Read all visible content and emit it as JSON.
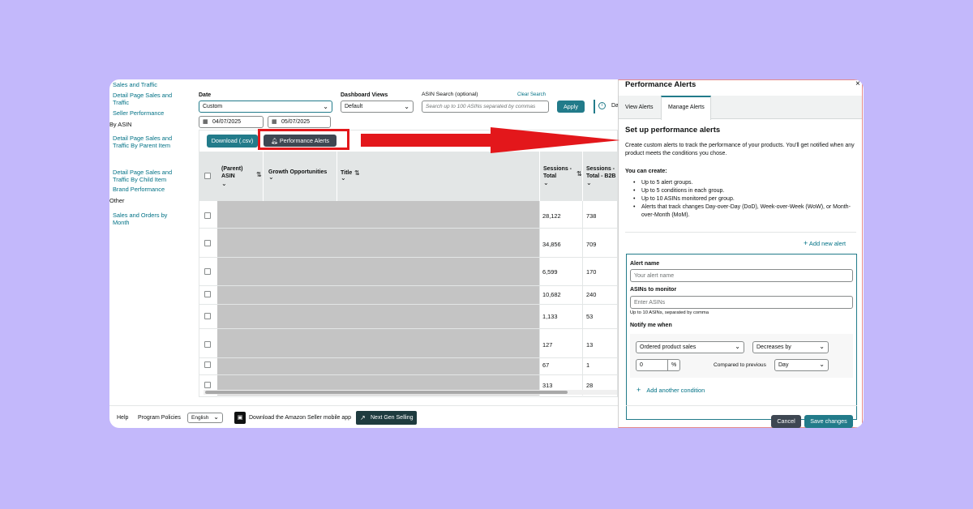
{
  "sidebar": {
    "sales_traffic": "Sales and Traffic",
    "detail_page_sales_traffic": "Detail Page Sales and Traffic",
    "seller_performance": "Seller Performance",
    "by_asin": "By ASIN",
    "detail_page_parent": "Detail Page Sales and Traffic By Parent Item",
    "detail_page_child": "Detail Page Sales and Traffic By Child Item",
    "brand_performance": "Brand Performance",
    "other": "Other",
    "sales_orders_month": "Sales and Orders by Month"
  },
  "filters": {
    "date_label": "Date",
    "date_value": "Custom",
    "start_date": "04/07/2025",
    "end_date": "05/07/2025",
    "views_label": "Dashboard Views",
    "views_value": "Default",
    "asin_label": "ASIN Search (optional)",
    "clear_search": "Clear Search",
    "asin_placeholder": "Search up to 100 ASINs separated by commas",
    "apply": "Apply",
    "truncated": "Da"
  },
  "toolbar": {
    "download": "Download (.csv)",
    "performance_alerts": "Performance Alerts"
  },
  "table": {
    "headers": [
      "(Parent) ASIN",
      "Growth Opportunities",
      "Title",
      "Sessions - Total",
      "Sessions - Total - B2B"
    ],
    "rows": [
      {
        "sessions": "28,122",
        "b2b": "738"
      },
      {
        "sessions": "34,856",
        "b2b": "709"
      },
      {
        "sessions": "6,599",
        "b2b": "170"
      },
      {
        "sessions": "10,682",
        "b2b": "240"
      },
      {
        "sessions": "1,133",
        "b2b": "53"
      },
      {
        "sessions": "127",
        "b2b": "13"
      },
      {
        "sessions": "67",
        "b2b": "1"
      },
      {
        "sessions": "313",
        "b2b": "28"
      }
    ]
  },
  "footer": {
    "help": "Help",
    "policies": "Program Policies",
    "language": "English",
    "download_app": "Download the Amazon Seller mobile app",
    "next_gen": "Next Gen Selling"
  },
  "panel": {
    "title": "Performance Alerts",
    "close": "×",
    "tab_view": "View Alerts",
    "tab_manage": "Manage Alerts",
    "heading": "Set up performance alerts",
    "description": "Create custom alerts to track the performance of your products. You'll get notified when any product meets the conditions you chose.",
    "you_can_create": "You can create:",
    "bullets": [
      "Up to 5 alert groups.",
      "Up to 5 conditions in each group.",
      "Up to 10 ASINs monitored per group.",
      "Alerts that track changes Day-over-Day (DoD), Week-over-Week (WoW), or Month-over-Month (MoM)."
    ],
    "add_new_alert": "Add new alert",
    "alert_name_label": "Alert name",
    "alert_name_placeholder": "Your alert name",
    "asins_label": "ASINs to monitor",
    "asins_placeholder": "Enter ASINs",
    "asins_hint": "Up to 10 ASINs, separated by comma",
    "notify_label": "Notify me when",
    "metric_value": "Ordered product sales",
    "change_value": "Decreases by",
    "amount_value": "0",
    "percent": "%",
    "compared_label": "Compared to previous",
    "period_value": "Day",
    "add_condition": "Add another condition",
    "cancel": "Cancel",
    "save": "Save changes"
  },
  "colors": {
    "background": "#c3b8fb",
    "accent_teal": "#227b8a",
    "annotation_red": "#e3171b"
  }
}
